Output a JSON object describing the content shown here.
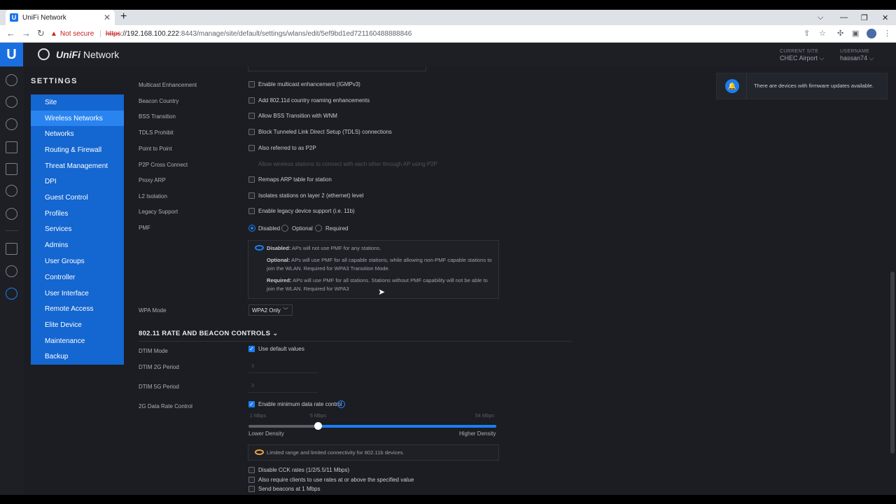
{
  "browser": {
    "tab_title": "UniFi Network",
    "tab_close": "✕",
    "new_tab": "+",
    "not_secure": "Not secure",
    "url_scheme": "https",
    "url_host": "://192.168.100.222",
    "url_path": ":8443/manage/site/default/settings/wlans/edit/5ef9bd1ed721160488888846"
  },
  "app": {
    "logo_letter": "U",
    "brand_bold": "UniFi",
    "brand_rest": " Network",
    "current_site_label": "CURRENT SITE",
    "current_site": "CHEC Airport",
    "username_label": "USERNAME",
    "username": "hassan74"
  },
  "sidebar": {
    "title": "SETTINGS",
    "group1": [
      "Site",
      "Wireless Networks",
      "Networks",
      "Routing & Firewall",
      "Threat Management",
      "DPI",
      "Guest Control",
      "Profiles",
      "Services",
      "Admins",
      "User Groups"
    ],
    "group2": [
      "Controller",
      "User Interface",
      "Remote Access",
      "Elite Device",
      "Maintenance",
      "Backup"
    ],
    "active": "Wireless Networks"
  },
  "form": {
    "rows": [
      {
        "label": "Multicast Enhancement",
        "option": "Enable multicast enhancement (IGMPv3)"
      },
      {
        "label": "Beacon Country",
        "option": "Add 802.11d country roaming enhancements"
      },
      {
        "label": "BSS Transition",
        "option": "Allow BSS Transition with WNM"
      },
      {
        "label": "TDLS Prohibit",
        "option": "Block Tunneled Link Direct Setup (TDLS) connections"
      },
      {
        "label": "Point to Point",
        "option": "Also referred to as P2P"
      },
      {
        "label": "P2P Cross Connect",
        "option": "Allow wireless stations to connect with each other through AP using P2P"
      },
      {
        "label": "Proxy ARP",
        "option": "Remaps ARP table for station"
      },
      {
        "label": "L2 Isolation",
        "option": "Isolates stations on layer 2 (ethernet) level"
      },
      {
        "label": "Legacy Support",
        "option": "Enable legacy device support (i.e. 11b)"
      }
    ],
    "pmf": {
      "label": "PMF",
      "options": [
        "Disabled",
        "Optional",
        "Required"
      ],
      "selected": "Disabled",
      "info_disabled_title": "Disabled:",
      "info_disabled": " APs will not use PMF for any stations.",
      "info_optional_title": "Optional:",
      "info_optional": " APs will use PMF for all capable stations, while allowing non-PMF capable stations to join the WLAN. Required for WPA3 Transition Mode.",
      "info_required_title": "Required:",
      "info_required": " APs will use PMF for all stations. Stations without PMF capability will not be able to join the WLAN. Required for WPA3"
    },
    "wpa_mode": {
      "label": "WPA Mode",
      "value": "WPA2 Only"
    }
  },
  "rate_section": {
    "title": "802.11 RATE AND BEACON CONTROLS",
    "dtim_mode_label": "DTIM Mode",
    "dtim_mode_option": "Use default values",
    "dtim_2g_label": "DTIM 2G Period",
    "dtim_2g_value": "3",
    "dtim_5g_label": "DTIM 5G Period",
    "dtim_5g_value": "3",
    "rate_label": "2G Data Rate Control",
    "rate_option": "Enable minimum data rate control",
    "info_icon": "i",
    "slider": {
      "min_label": "1 Mbps",
      "value_label": "6 Mbps",
      "max_label": "54 Mbps",
      "value": 6,
      "fraction": 0.28,
      "low": "Lower Density",
      "high": "Higher Density"
    },
    "warning": "Limited range and limited connectivity for 802.11b devices.",
    "extra_options": [
      "Disable CCK rates (1/2/5.5/11 Mbps)",
      "Also require clients to use rates at or above the specified value",
      "Send beacons at 1 Mbps"
    ]
  },
  "notification": {
    "text": "There are devices with firmware updates available."
  },
  "colors": {
    "accent": "#1a7ef2",
    "sidebar": "#1466d0",
    "warning": "#e8a33d"
  }
}
